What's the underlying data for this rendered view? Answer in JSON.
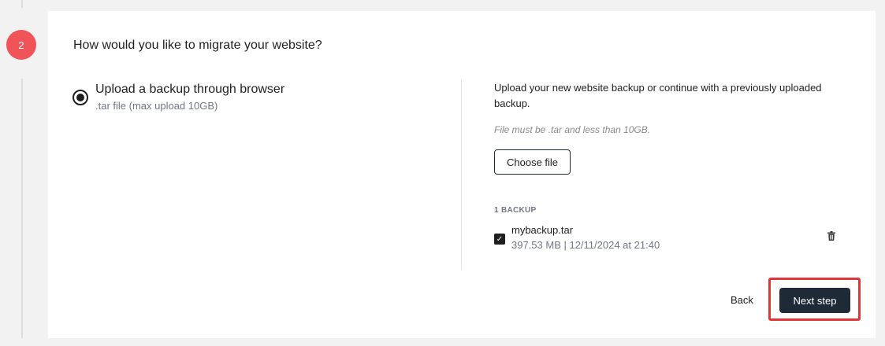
{
  "step": {
    "number": "2"
  },
  "title": "How would you like to migrate your website?",
  "option": {
    "label": "Upload a backup through browser",
    "sublabel": ".tar file (max upload 10GB)",
    "selected": true
  },
  "upload": {
    "description": "Upload your new website backup or continue with a previously uploaded backup.",
    "hint": "File must be .tar and less than 10GB.",
    "choose_label": "Choose file"
  },
  "backups": {
    "count_label": "1 BACKUP",
    "items": [
      {
        "name": "mybackup.tar",
        "meta": "397.53 MB | 12/11/2024 at 21:40",
        "checked": true
      }
    ]
  },
  "footer": {
    "back_label": "Back",
    "next_label": "Next step"
  },
  "colors": {
    "step_badge": "#f05459",
    "primary_button": "#1f2a37",
    "highlight_border": "#e3343a"
  },
  "icons": {
    "check": "checkmark-icon",
    "delete": "trash-icon"
  }
}
